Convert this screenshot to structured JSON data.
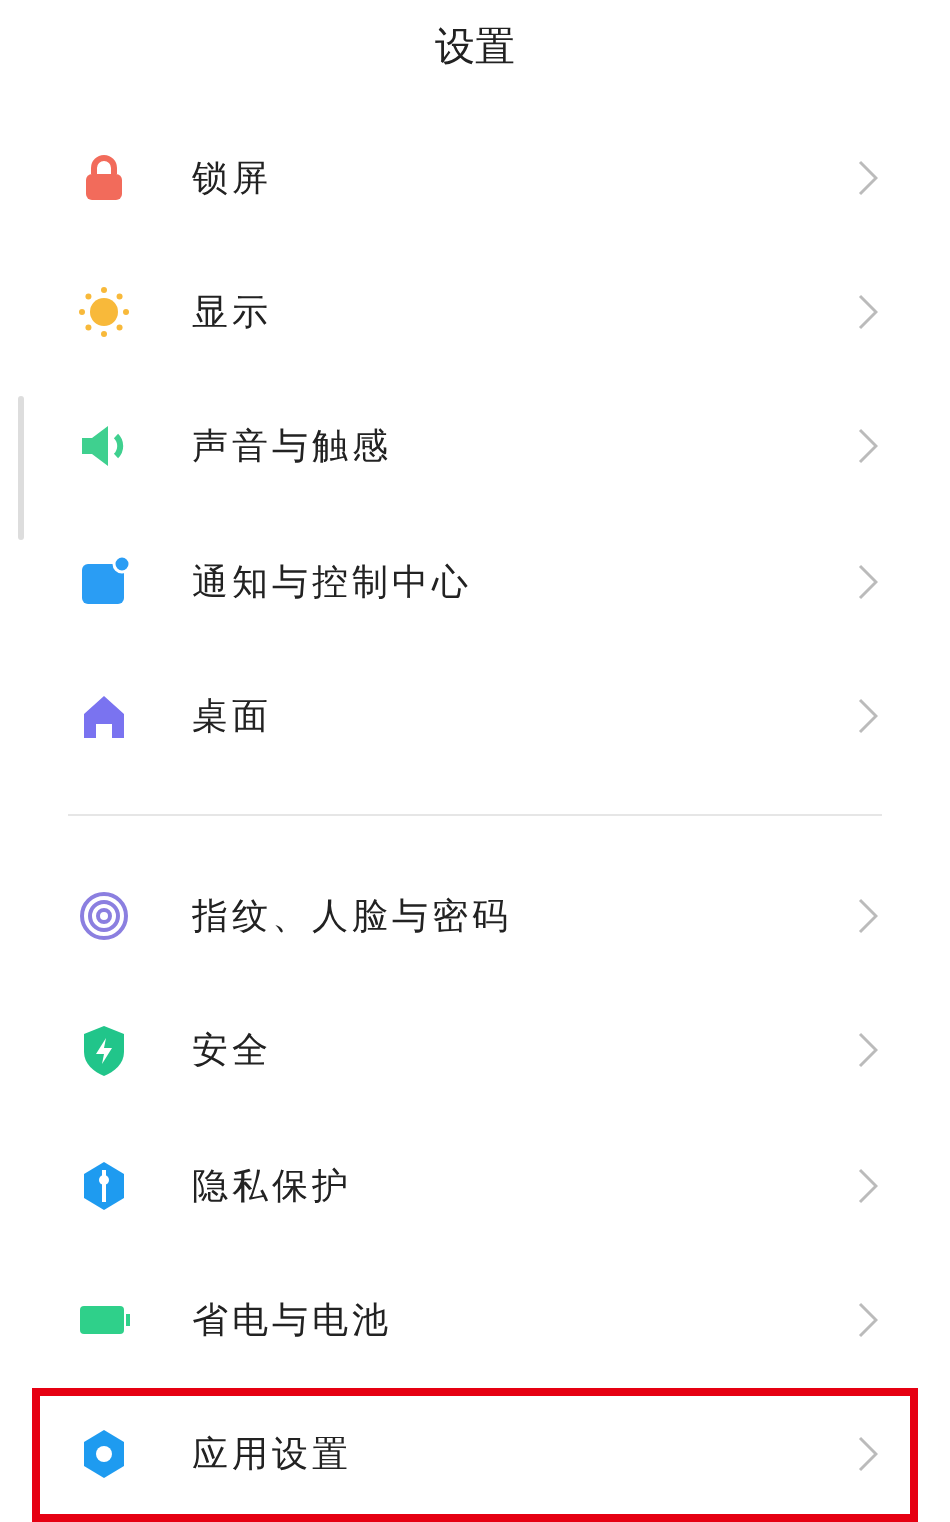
{
  "title": "设置",
  "groups": [
    {
      "items": [
        {
          "label": "锁屏",
          "highlighted": false
        },
        {
          "label": "显示",
          "highlighted": false
        },
        {
          "label": "声音与触感",
          "highlighted": false
        },
        {
          "label": "通知与控制中心",
          "highlighted": false
        },
        {
          "label": "桌面",
          "highlighted": false
        }
      ]
    },
    {
      "items": [
        {
          "label": "指纹、人脸与密码",
          "highlighted": false
        },
        {
          "label": "安全",
          "highlighted": false
        },
        {
          "label": "隐私保护",
          "highlighted": false
        },
        {
          "label": "省电与电池",
          "highlighted": false
        },
        {
          "label": "应用设置",
          "highlighted": true
        }
      ]
    }
  ]
}
